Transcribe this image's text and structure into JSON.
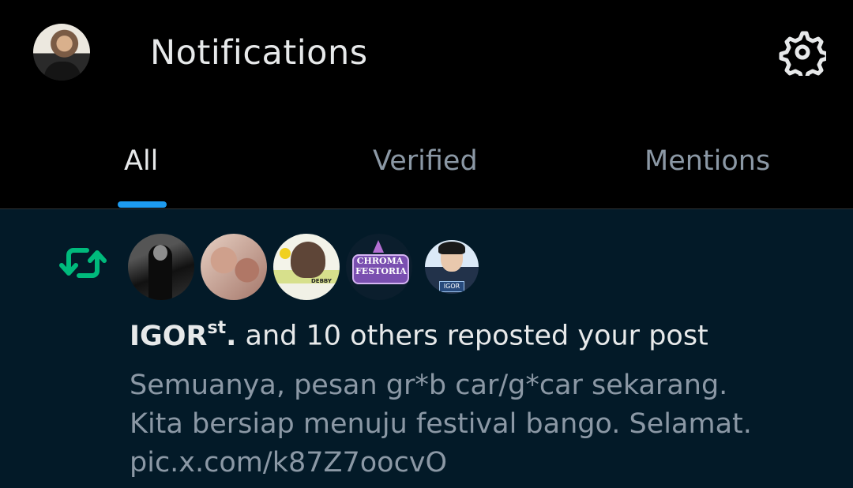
{
  "header": {
    "title": "Notifications",
    "settings_icon": "gear-icon",
    "avatar_icon": "profile-avatar"
  },
  "tabs": [
    {
      "label": "All",
      "active": true
    },
    {
      "label": "Verified",
      "active": false
    },
    {
      "label": "Mentions",
      "active": false
    }
  ],
  "colors": {
    "background": "#000000",
    "content_background": "#031a28",
    "accent": "#1d9bf0",
    "repost_green": "#00ba7c",
    "text_primary": "#e7e9ea",
    "text_secondary": "#8b98a5"
  },
  "notification": {
    "icon": "repost-icon",
    "actor_name": "IGOR",
    "actor_suffix": "st",
    "actor_period": ".",
    "action_text": " and 10 others reposted your post",
    "post_lines": [
      "Semuanya, pesan gr*b car/g*car sekarang.",
      "Kita bersiap menuju festival bango. Selamat.",
      "pic.x.com/k87Z7oocvO"
    ],
    "avatar_badge_text": "CHROMA FESTORIA",
    "avatar_label_3": "DEBBY",
    "avatar_label_5": "IGOR"
  }
}
